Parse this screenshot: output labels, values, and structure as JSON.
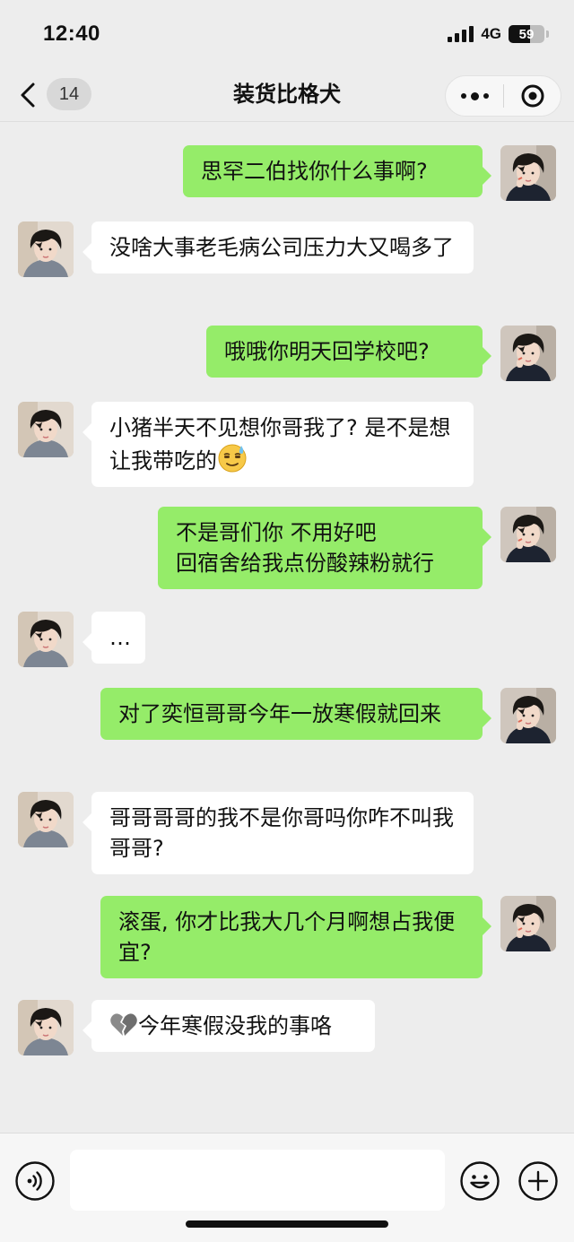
{
  "status_bar": {
    "time": "12:40",
    "network": "4G",
    "battery_text": "59",
    "battery_level": 0.59
  },
  "nav": {
    "back_icon": "chevron-left-icon",
    "unread_count": "14",
    "title": "装货比格犬",
    "more_icon": "more-dots-icon",
    "close_icon": "target-close-icon"
  },
  "messages": [
    {
      "dir": "out",
      "text": "思罕二伯找你什么事啊?"
    },
    {
      "dir": "in",
      "text": "没啥大事老毛病公司压力大又喝多了"
    },
    {
      "dir": "out",
      "text": "哦哦你明天回学校吧?"
    },
    {
      "dir": "in",
      "text": "小猪半天不见想你哥我了? 是不是想让我带吃的",
      "trailing_emoji": "sweat-smile-emoji"
    },
    {
      "dir": "out",
      "text": "不是哥们你 不用好吧\n回宿舍给我点份酸辣粉就行"
    },
    {
      "dir": "in",
      "text": "…"
    },
    {
      "dir": "out",
      "text": "对了奕恒哥哥今年一放寒假就回来"
    },
    {
      "dir": "in",
      "text": "哥哥哥哥的我不是你哥吗你咋不叫我哥哥?"
    },
    {
      "dir": "out",
      "text": "滚蛋, 你才比我大几个月啊想占我便宜?"
    },
    {
      "dir": "in",
      "text": "今年寒假没我的事咯",
      "leading_emoji": "broken-heart-emoji"
    }
  ],
  "input_bar": {
    "voice_icon": "voice-icon",
    "input_value": "",
    "emoji_icon": "emoji-face-icon",
    "plus_icon": "plus-icon"
  },
  "colors": {
    "background": "#ededed",
    "outgoing_bubble": "#95ec69",
    "incoming_bubble": "#ffffff"
  }
}
